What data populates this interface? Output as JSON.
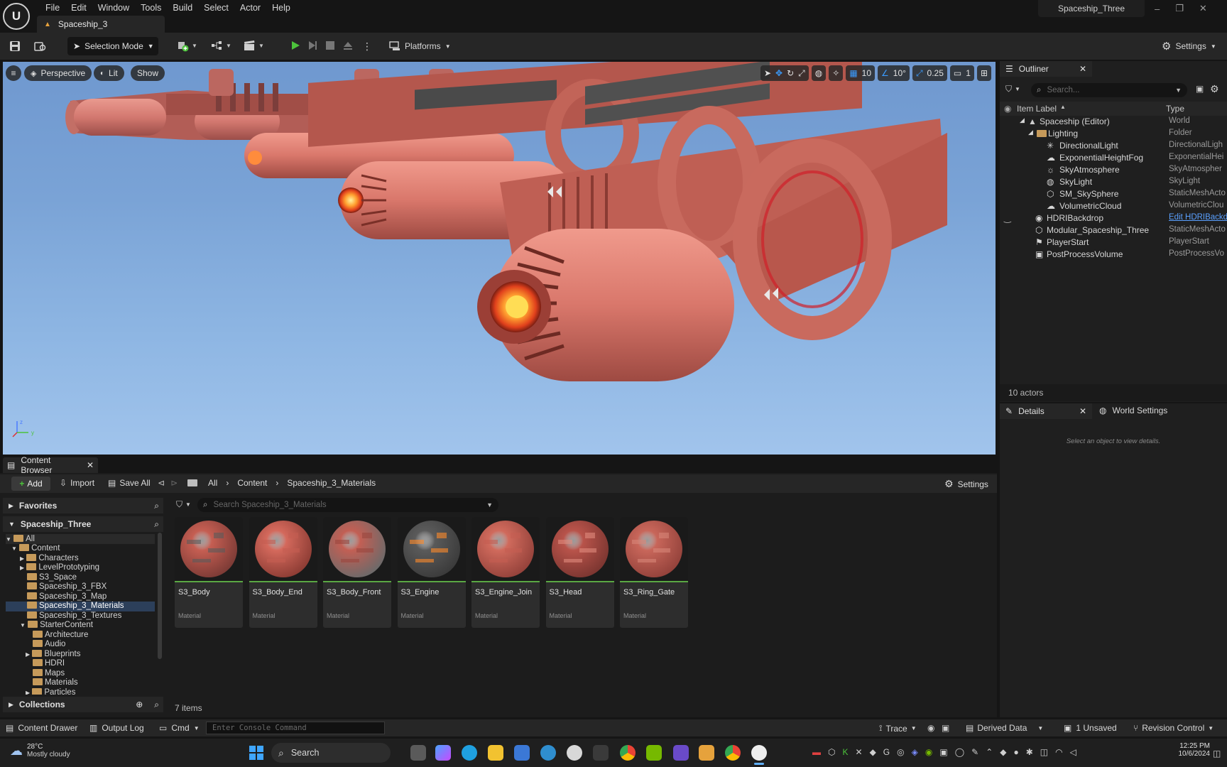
{
  "menu": [
    "File",
    "Edit",
    "Window",
    "Tools",
    "Build",
    "Select",
    "Actor",
    "Help"
  ],
  "doc_tab": "Spaceship_3",
  "project_name": "Spaceship_Three",
  "toolbar": {
    "selection_mode": "Selection Mode",
    "platforms": "Platforms",
    "settings": "Settings"
  },
  "viewport": {
    "perspective": "Perspective",
    "lit": "Lit",
    "show": "Show",
    "grid": "10",
    "rotate": "10°",
    "scale": "0.25",
    "camera": "1"
  },
  "outliner": {
    "title": "Outliner",
    "search_placeholder": "Search...",
    "col_label": "Item Label",
    "col_type": "Type",
    "rows": [
      {
        "label": "Spaceship (Editor)",
        "type": "World"
      },
      {
        "label": "Lighting",
        "type": "Folder"
      },
      {
        "label": "DirectionalLight",
        "type": "DirectionalLigh"
      },
      {
        "label": "ExponentialHeightFog",
        "type": "ExponentialHei"
      },
      {
        "label": "SkyAtmosphere",
        "type": "SkyAtmospher"
      },
      {
        "label": "SkyLight",
        "type": "SkyLight"
      },
      {
        "label": "SM_SkySphere",
        "type": "StaticMeshActo"
      },
      {
        "label": "VolumetricCloud",
        "type": "VolumetricClou"
      },
      {
        "label": "HDRIBackdrop",
        "type": "Edit HDRIBackd"
      },
      {
        "label": "Modular_Spaceship_Three",
        "type": "StaticMeshActo"
      },
      {
        "label": "PlayerStart",
        "type": "PlayerStart"
      },
      {
        "label": "PostProcessVolume",
        "type": "PostProcessVo"
      }
    ],
    "actor_count": "10 actors"
  },
  "details": {
    "tab": "Details",
    "world_settings": "World Settings",
    "empty_message": "Select an object to view details."
  },
  "content_browser": {
    "tab": "Content Browser",
    "add": "Add",
    "import": "Import",
    "save_all": "Save All",
    "breadcrumb": [
      "All",
      "Content",
      "Spaceship_3_Materials"
    ],
    "settings": "Settings",
    "favorites": "Favorites",
    "project": "Spaceship_Three",
    "tree": [
      "All",
      "Content",
      "Characters",
      "LevelPrototyping",
      "S3_Space",
      "Spaceship_3_FBX",
      "Spaceship_3_Map",
      "Spaceship_3_Materials",
      "Spaceship_3_Textures",
      "StarterContent",
      "Architecture",
      "Audio",
      "Blueprints",
      "HDRI",
      "Maps",
      "Materials",
      "Particles"
    ],
    "search_placeholder": "Search Spaceship_3_Materials",
    "assets": [
      {
        "name": "S3_Body",
        "type": "Material"
      },
      {
        "name": "S3_Body_End",
        "type": "Material"
      },
      {
        "name": "S3_Body_Front",
        "type": "Material"
      },
      {
        "name": "S3_Engine",
        "type": "Material"
      },
      {
        "name": "S3_Engine_Join",
        "type": "Material"
      },
      {
        "name": "S3_Head",
        "type": "Material"
      },
      {
        "name": "S3_Ring_Gate",
        "type": "Material"
      }
    ],
    "collections": "Collections",
    "item_count": "7 items"
  },
  "statusbar": {
    "content_drawer": "Content Drawer",
    "output_log": "Output Log",
    "cmd": "Cmd",
    "console_placeholder": "Enter Console Command",
    "trace": "Trace",
    "derived_data": "Derived Data",
    "unsaved": "1 Unsaved",
    "revision_control": "Revision Control"
  },
  "taskbar": {
    "weather_temp": "28°C",
    "weather_desc": "Mostly cloudy",
    "search": "Search",
    "time": "12:25 PM",
    "date": "10/6/2024"
  },
  "colors": {
    "accent_blue": "#3a9bff",
    "play_green": "#4cc33b",
    "folder": "#c69a5a",
    "ship_red": "#d9776b"
  }
}
